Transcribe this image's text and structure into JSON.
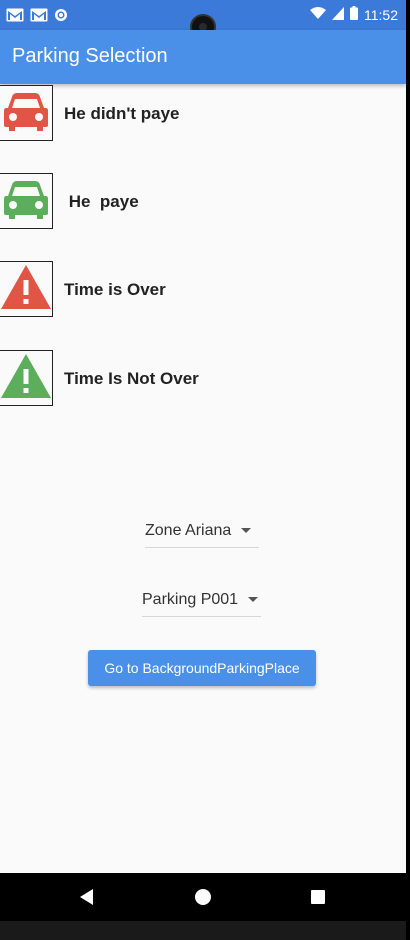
{
  "status_bar": {
    "time": "11:52",
    "icons": [
      "gmail-icon",
      "gmail-icon",
      "sync-icon",
      "wifi-icon",
      "signal-icon",
      "battery-icon"
    ]
  },
  "app_bar": {
    "title": "Parking Selection"
  },
  "legend": [
    {
      "icon": "car-icon",
      "color": "#e05545",
      "label": "He didn't paye"
    },
    {
      "icon": "car-icon",
      "color": "#5cad5c",
      "label": " He  paye"
    },
    {
      "icon": "warning-icon",
      "color": "#e05545",
      "label": "Time is Over"
    },
    {
      "icon": "warning-icon",
      "color": "#5cad5c",
      "label": "Time Is Not Over"
    }
  ],
  "zone_dropdown": {
    "value": "Zone Ariana"
  },
  "parking_dropdown": {
    "value": "Parking P001"
  },
  "go_button": {
    "label": "Go to BackgroundParkingPlace"
  },
  "nav_bar": {
    "icons": [
      "back-icon",
      "home-icon",
      "recents-icon"
    ]
  },
  "colors": {
    "status_bar": "#3b7ad8",
    "app_bar": "#4a90e8",
    "accent": "#4a90e8",
    "red": "#e05545",
    "green": "#5cad5c"
  }
}
